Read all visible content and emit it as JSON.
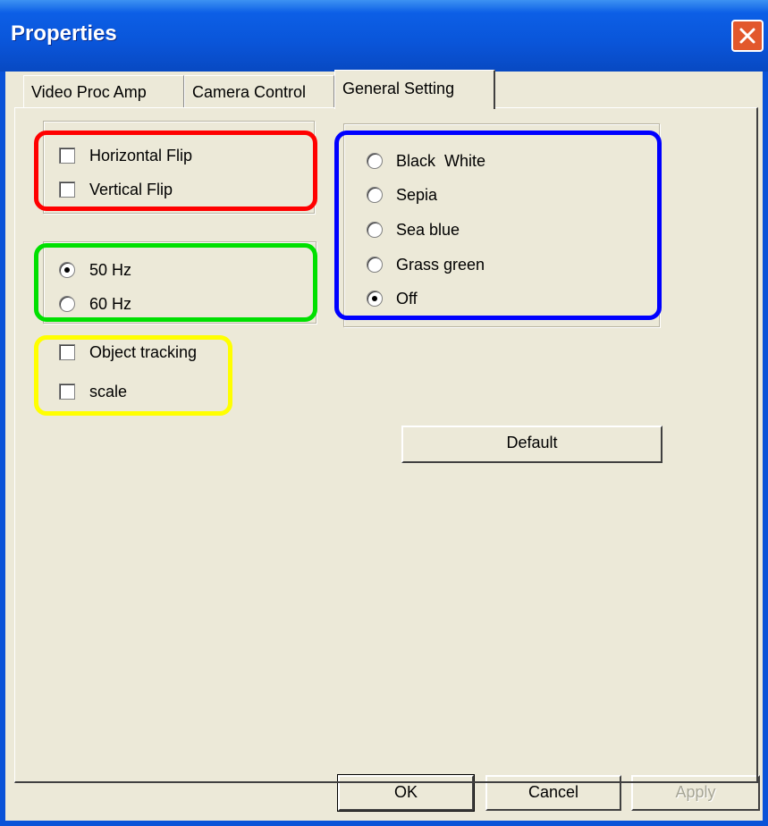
{
  "window": {
    "title": "Properties",
    "close_icon": "close-icon"
  },
  "tabs": [
    {
      "label": "Video Proc Amp",
      "active": false
    },
    {
      "label": "Camera Control",
      "active": false
    },
    {
      "label": "General Setting",
      "active": true
    }
  ],
  "flip_group": {
    "items": [
      {
        "label": "Horizontal Flip",
        "checked": false
      },
      {
        "label": "Vertical Flip",
        "checked": false
      }
    ]
  },
  "frequency_group": {
    "items": [
      {
        "label": "50 Hz",
        "selected": true
      },
      {
        "label": "60 Hz",
        "selected": false
      }
    ]
  },
  "tracking_group": {
    "items": [
      {
        "label": "Object tracking",
        "checked": false
      },
      {
        "label": "scale",
        "checked": false
      }
    ]
  },
  "color_effect_group": {
    "items": [
      {
        "label": "Black  White",
        "selected": false
      },
      {
        "label": "Sepia",
        "selected": false
      },
      {
        "label": "Sea blue",
        "selected": false
      },
      {
        "label": "Grass green",
        "selected": false
      },
      {
        "label": "Off",
        "selected": true
      }
    ]
  },
  "buttons": {
    "default_label": "Default",
    "ok_label": "OK",
    "cancel_label": "Cancel",
    "apply_label": "Apply",
    "apply_enabled": false
  },
  "highlight_colors": {
    "flip": "#ff0000",
    "frequency": "#00e000",
    "tracking": "#ffff00",
    "color_effect": "#0000ff"
  }
}
